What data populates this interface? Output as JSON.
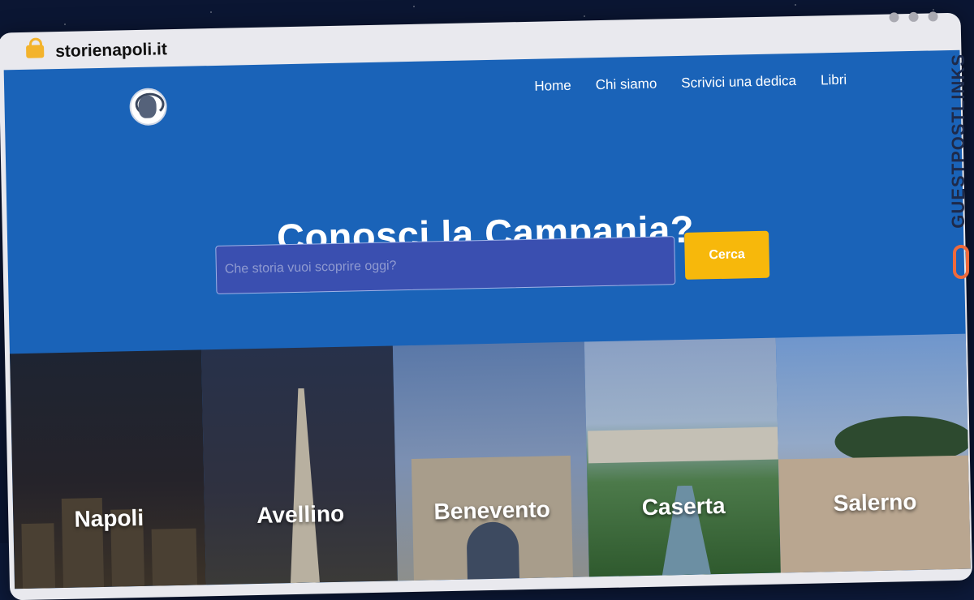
{
  "browser": {
    "url": "storienapoli.it"
  },
  "nav": {
    "items": [
      "Home",
      "Chi siamo",
      "Scrivici una dedica",
      "Libri"
    ]
  },
  "hero": {
    "title": "Conosci la Campania?",
    "search_placeholder": "Che storia vuoi scoprire oggi?",
    "search_button": "Cerca"
  },
  "cities": [
    "Napoli",
    "Avellino",
    "Benevento",
    "Caserta",
    "Salerno"
  ],
  "watermark": {
    "text": "GUESTPOSTLINKS"
  },
  "colors": {
    "brand_blue": "#1a63b8",
    "search_button": "#f7b80b"
  }
}
